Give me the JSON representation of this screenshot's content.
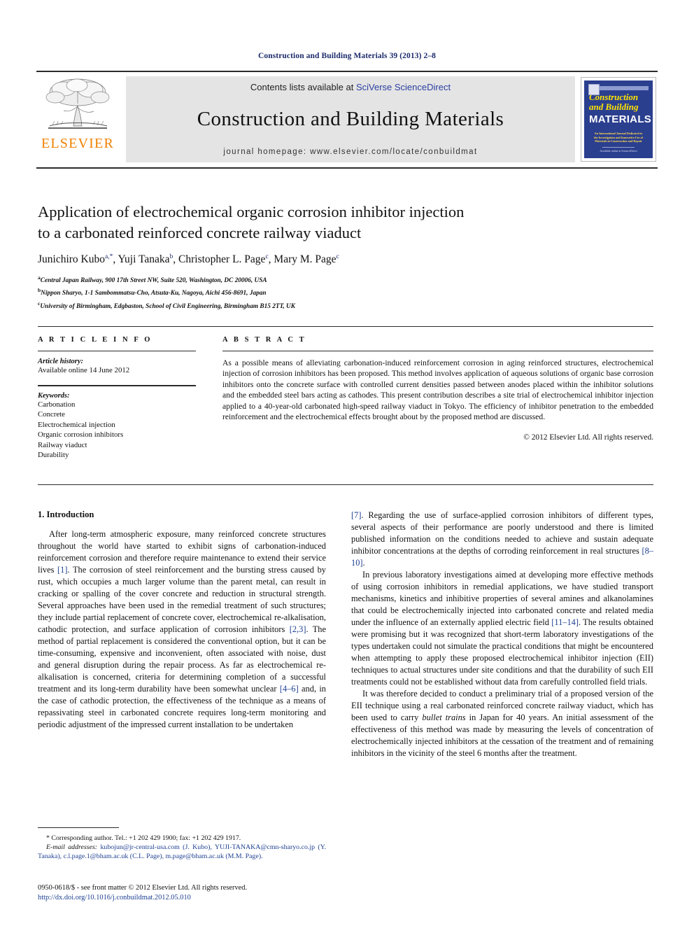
{
  "running_head": "Construction and Building Materials 39 (2013) 2–8",
  "masthead": {
    "publisher_logo_name": "elsevier-tree-logo",
    "publisher_wordmark": "ELSEVIER",
    "contents_prefix": "Contents lists available at ",
    "contents_link": "SciVerse ScienceDirect",
    "journal_title": "Construction and Building Materials",
    "homepage_label": "journal homepage: www.elsevier.com/locate/conbuildmat",
    "cover": {
      "line1": "Construction",
      "line2": "and Building",
      "line3": "MATERIALS",
      "subtitle": "An International Journal Dedicated to the Investigation and Innovative Use of Materials in Construction and Repair",
      "footer": "Available online at ScienceDirect"
    }
  },
  "article": {
    "title_line1": "Application of electrochemical organic corrosion inhibitor injection",
    "title_line2": "to a carbonated reinforced concrete railway viaduct",
    "authors": [
      {
        "name": "Junichiro Kubo",
        "sup": "a,*"
      },
      {
        "name": "Yuji Tanaka",
        "sup": "b"
      },
      {
        "name": "Christopher L. Page",
        "sup": "c"
      },
      {
        "name": "Mary M. Page",
        "sup": "c"
      }
    ],
    "affiliations": [
      {
        "mark": "a",
        "text": "Central Japan Railway, 900 17th Street NW, Suite 520, Washington, DC 20006, USA"
      },
      {
        "mark": "b",
        "text": "Nippon Sharyo, 1-1 Sambommatsu-Cho, Atsuta-Ku, Nagoya, Aichi 456-8691, Japan"
      },
      {
        "mark": "c",
        "text": "University of Birmingham, Edgbaston, School of Civil Engineering, Birmingham B15 2TT, UK"
      }
    ]
  },
  "article_info": {
    "heading": "A R T I C L E   I N F O",
    "history_label": "Article history:",
    "history_value": "Available online 14 June 2012",
    "keywords_label": "Keywords:",
    "keywords": [
      "Carbonation",
      "Concrete",
      "Electrochemical injection",
      "Organic corrosion inhibitors",
      "Railway viaduct",
      "Durability"
    ]
  },
  "abstract": {
    "heading": "A B S T R A C T",
    "text": "As a possible means of alleviating carbonation-induced reinforcement corrosion in aging reinforced structures, electrochemical injection of corrosion inhibitors has been proposed. This method involves application of aqueous solutions of organic base corrosion inhibitors onto the concrete surface with controlled current densities passed between anodes placed within the inhibitor solutions and the embedded steel bars acting as cathodes. This present contribution describes a site trial of electrochemical inhibitor injection applied to a 40-year-old carbonated high-speed railway viaduct in Tokyo. The efficiency of inhibitor penetration to the embedded reinforcement and the electrochemical effects brought about by the proposed method are discussed.",
    "copyright": "© 2012 Elsevier Ltd. All rights reserved."
  },
  "body": {
    "section_heading": "1. Introduction",
    "left_p1_a": "After long-term atmospheric exposure, many reinforced concrete structures throughout the world have started to exhibit signs of carbonation-induced reinforcement corrosion and therefore require maintenance to extend their service lives ",
    "left_p1_ref1": "[1]",
    "left_p1_b": ". The corrosion of steel reinforcement and the bursting stress caused by rust, which occupies a much larger volume than the parent metal, can result in cracking or spalling of the cover concrete and reduction in structural strength. Several approaches have been used in the remedial treatment of such structures; they include partial replacement of concrete cover, electrochemical re-alkalisation, cathodic protection, and surface application of corrosion inhibitors ",
    "left_p1_ref2": "[2,3]",
    "left_p1_c": ". The method of partial replacement is considered the conventional option, but it can be time-consuming, expensive and inconvenient, often associated with noise, dust and general disruption during the repair process. As far as electrochemical re-alkalisation is concerned, criteria for determining completion of a successful treatment and its long-term durability have been somewhat unclear ",
    "left_p1_ref3": "[4–6]",
    "left_p1_d": " and, in the case of cathodic protection, the effectiveness of the technique as a means of repassivating steel in carbonated concrete requires long-term monitoring and periodic adjustment of the impressed current installation to be undertaken",
    "right_p1_ref0": "[7]",
    "right_p1_a": ". Regarding the use of surface-applied corrosion inhibitors of different types, several aspects of their performance are poorly understood and there is limited published information on the conditions needed to achieve and sustain adequate inhibitor concentrations at the depths of corroding reinforcement in real structures ",
    "right_p1_ref1": "[8–10]",
    "right_p1_b": ".",
    "right_p2_a": "In previous laboratory investigations aimed at developing more effective methods of using corrosion inhibitors in remedial applications, we have studied transport mechanisms, kinetics and inhibitive properties of several amines and alkanolamines that could be electrochemically injected into carbonated concrete and related media under the influence of an externally applied electric field ",
    "right_p2_ref1": "[11–14]",
    "right_p2_b": ". The results obtained were promising but it was recognized that short-term laboratory investigations of the types undertaken could not simulate the practical conditions that might be encountered when attempting to apply these proposed electrochemical inhibitor injection (EII) techniques to actual structures under site conditions and that the durability of such EII treatments could not be established without data from carefully controlled field trials.",
    "right_p3_a": "It was therefore decided to conduct a preliminary trial of a proposed version of the EII technique using a real carbonated reinforced concrete railway viaduct, which has been used to carry ",
    "right_p3_ital": "bullet trains",
    "right_p3_b": " in Japan for 40 years. An initial assessment of the effectiveness of this method was made by measuring the levels of concentration of electrochemically injected inhibitors at the cessation of the treatment and of remaining inhibitors in the vicinity of the steel 6 months after the treatment."
  },
  "footnote": {
    "corresponding": "* Corresponding author. Tel.: +1 202 429 1900; fax: +1 202 429 1917.",
    "email_label": "E-mail addresses:",
    "emails": "kubojun@jr-central-usa.com (J. Kubo), YUJI-TANAKA@cmn-sharyo.co.jp (Y. Tanaka), c.l.page.1@bham.ac.uk (C.L. Page), m.page@bham.ac.uk (M.M. Page)."
  },
  "colophon": {
    "front_matter": "0950-0618/$ - see front matter © 2012 Elsevier Ltd. All rights reserved.",
    "doi": "http://dx.doi.org/10.1016/j.conbuildmat.2012.05.010"
  },
  "colors": {
    "link_blue": "#1d3f91",
    "running_head_blue": "#1d2b6b",
    "elsevier_orange": "#F08000",
    "band_gray": "#e4e4e4",
    "cover_blue": "#2b3f8f",
    "cover_yellow": "#ffe400"
  }
}
